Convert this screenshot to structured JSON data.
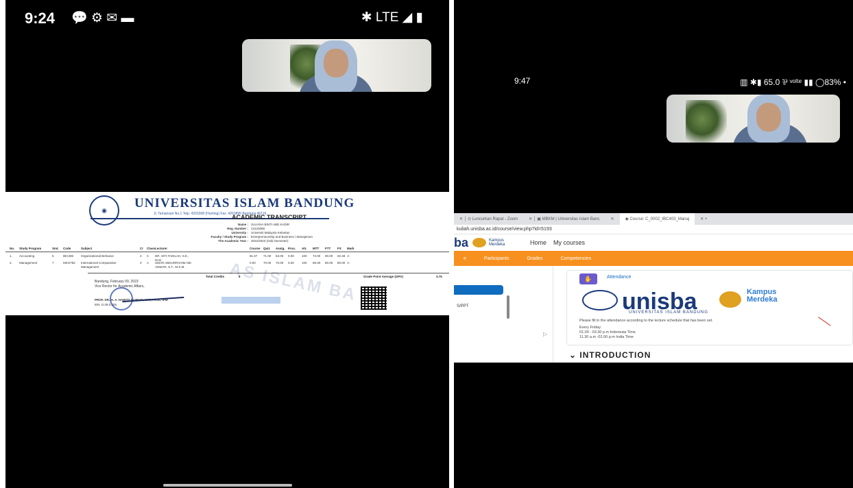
{
  "left_phone": {
    "status": {
      "time": "9:24",
      "icons": "💬 ⚙ ✉ ▬",
      "right": "✱ LTE ◢ ▮"
    },
    "transcript": {
      "university": "UNIVERSITAS ISLAM BANDUNG",
      "address": "Jl. Tamansari No.1 Telp. 4203368 (Hunting) Fax. 4263895 Bandung 40116",
      "title": "ACADEMIC TRANSCRIPT",
      "info": [
        {
          "k": "Name :",
          "v": "JULIANA BINTI ABD KADIR"
        },
        {
          "k": "Reg. Number :",
          "v": "13123088"
        },
        {
          "k": "University :",
          "v": "Universiti Malaysia Kelantan"
        },
        {
          "k": "Faculty / Study Program :",
          "v": "Entrepreneurship and Business / Manajemen"
        },
        {
          "k": "The Academic Year :",
          "v": "2022/2023 (Odd Semester)"
        }
      ],
      "headers": [
        "No.",
        "Study Program",
        "Smt.",
        "Code",
        "Subject",
        "Cr",
        "Class",
        "Lecturer",
        "Course",
        "Quiz",
        "Assig.",
        "Proc.",
        "Att.",
        "MTT",
        "FTT",
        "FS",
        "Mark"
      ],
      "rows": [
        [
          "1.",
          "Accounting",
          "5",
          "IBC306",
          "Organizational Behavior",
          "3",
          "C",
          "DR. SITI FADILAH, S.E., M.Si.",
          "81.07",
          "71.00",
          "83.00",
          "0.00",
          "100",
          "72.00",
          "90.00",
          "82.48",
          "A-"
        ],
        [
          "2.",
          "Management",
          "7",
          "MKO782",
          "International Comparative Management",
          "3",
          "A",
          "UMAR ABDURRAHIM ABI ANWAR, S.T., M.S.M.",
          "0.00",
          "70.00",
          "70.00",
          "0.00",
          "100",
          "85.00",
          "80.00",
          "80.00",
          "A-"
        ]
      ],
      "total_label": "Total Credits",
      "total_value": "6",
      "gpa_label": "Grade Point Average (GPA)",
      "gpa_value": "3.75",
      "sign_place": "Bandung, February 09, 2023",
      "sign_role": "Vice Rector for Academic Affairs,",
      "signer": "PROF. DR. H. A. HARITS NU'MAN, M.T., PH.D., IPM",
      "signer_id": "EIN. D.09.0.305",
      "watermark": "AS ISLAM BA"
    }
  },
  "right_phone": {
    "status": {
      "time": "9:47",
      "right": "▥ ✱▮ 65.0 ⅌ ᵛᵒˡᵗᵉ ▮▮ ◯83% •"
    },
    "browser": {
      "tabs": [
        "✕ │ ⊙ Luncurkan Rapat - Zoom",
        "✕ │ ▣ MBKM | Universitas Islam Banc",
        "✕",
        "◉ Course: C_0002_IBC403_Manaj",
        "✕ +"
      ],
      "url": "kuliah.unisba.ac.id/course/view.php?id=5193",
      "nav_logo": "ba",
      "nav_merdeka": "Kampus Merdeka",
      "nav_links": [
        "Home",
        "My courses"
      ],
      "course_tabs": [
        "e",
        "Participants",
        "Grades",
        "Competencies"
      ],
      "side_text": "S/PPT",
      "attendance_label": "Attendance",
      "unisba_word": "unisba",
      "unisba_sub": "UNIVERSITAS ISLAM BANDUNG",
      "kampus": "Kampus",
      "merdeka": "Merdeka",
      "note_lines": [
        "Please fill in the attendance according to the lecture schedule that has been set.",
        "Every Friday.",
        "01.00 - 03.30 p.m Indonesia Time",
        "11.30 a.m -02.00 p.m India Time"
      ],
      "intro": "INTRODUCTION"
    }
  }
}
